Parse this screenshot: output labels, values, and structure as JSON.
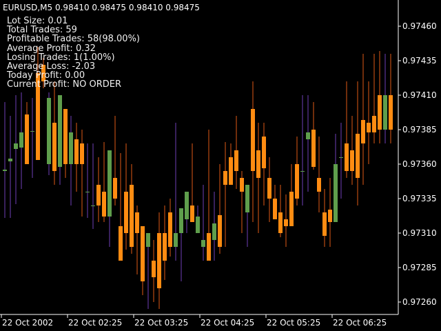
{
  "header": {
    "symbol": "EURUSD,M5",
    "ohlc": "0.98410 0.98475 0.98410 0.98475"
  },
  "stats": [
    "Lot Size: 0.01",
    "Total Trades: 59",
    "Profitable Trades: 58(98.00%)",
    "Average Profit: 0.32",
    "Losing Trades: 1(1.00%)",
    "Average Loss: -2.03",
    "Today Profit: 0.00",
    "Current Profit: NO ORDER"
  ],
  "colors": {
    "background": "#000000",
    "up_body": "#5f9e4c",
    "down_body": "#ff8c12",
    "up_wick": "#6f3fb7",
    "down_wick": "#e05a16",
    "axis": "#ffffff",
    "text": "#f0f0f0"
  },
  "chart_data": {
    "type": "candlestick",
    "y_ticks": [
      "0.97460",
      "0.97435",
      "0.97410",
      "0.97385",
      "0.97360",
      "0.97335",
      "0.97310",
      "0.97285",
      "0.97260"
    ],
    "x_ticks": [
      "22 Oct 2002",
      "22 Oct 02:25",
      "22 Oct 03:25",
      "22 Oct 04:25",
      "22 Oct 05:25",
      "22 Oct 06:25"
    ],
    "ylim": [
      0.97251,
      0.97479
    ],
    "candles": [
      {
        "o": 0.97355,
        "h": 0.97405,
        "l": 0.97321,
        "c": 0.97356
      },
      {
        "o": 0.97362,
        "h": 0.97395,
        "l": 0.97321,
        "c": 0.97364
      },
      {
        "o": 0.97371,
        "h": 0.9741,
        "l": 0.97331,
        "c": 0.97375
      },
      {
        "o": 0.97372,
        "h": 0.97412,
        "l": 0.97342,
        "c": 0.97383
      },
      {
        "o": 0.97396,
        "h": 0.97405,
        "l": 0.9736,
        "c": 0.9736
      },
      {
        "o": 0.97384,
        "h": 0.97408,
        "l": 0.9735,
        "c": 0.97384
      },
      {
        "o": 0.97426,
        "h": 0.97445,
        "l": 0.97363,
        "c": 0.97363
      },
      {
        "o": 0.97432,
        "h": 0.97437,
        "l": 0.97415,
        "c": 0.9742
      },
      {
        "o": 0.9736,
        "h": 0.97412,
        "l": 0.97352,
        "c": 0.97408
      },
      {
        "o": 0.9739,
        "h": 0.9742,
        "l": 0.97345,
        "c": 0.97355
      },
      {
        "o": 0.97358,
        "h": 0.97398,
        "l": 0.97345,
        "c": 0.9741
      },
      {
        "o": 0.974,
        "h": 0.974,
        "l": 0.9735,
        "c": 0.9736
      },
      {
        "o": 0.9736,
        "h": 0.97395,
        "l": 0.9733,
        "c": 0.97383
      },
      {
        "o": 0.97378,
        "h": 0.9739,
        "l": 0.9734,
        "c": 0.9736
      },
      {
        "o": 0.97375,
        "h": 0.97385,
        "l": 0.97322,
        "c": 0.9736
      },
      {
        "o": 0.9734,
        "h": 0.97375,
        "l": 0.97321,
        "c": 0.9734
      },
      {
        "o": 0.9733,
        "h": 0.97375,
        "l": 0.97313,
        "c": 0.9733
      },
      {
        "o": 0.97345,
        "h": 0.97365,
        "l": 0.97318,
        "c": 0.9733
      },
      {
        "o": 0.9734,
        "h": 0.97376,
        "l": 0.97318,
        "c": 0.97322
      },
      {
        "o": 0.97322,
        "h": 0.9734,
        "l": 0.973,
        "c": 0.9737
      },
      {
        "o": 0.9735,
        "h": 0.97395,
        "l": 0.9733,
        "c": 0.97335
      },
      {
        "o": 0.97315,
        "h": 0.97368,
        "l": 0.97298,
        "c": 0.9729
      },
      {
        "o": 0.9734,
        "h": 0.97375,
        "l": 0.97298,
        "c": 0.9731
      },
      {
        "o": 0.97345,
        "h": 0.9736,
        "l": 0.97295,
        "c": 0.973
      },
      {
        "o": 0.97325,
        "h": 0.9733,
        "l": 0.9728,
        "c": 0.9731
      },
      {
        "o": 0.97315,
        "h": 0.97315,
        "l": 0.97265,
        "c": 0.97275
      },
      {
        "o": 0.973,
        "h": 0.9731,
        "l": 0.97255,
        "c": 0.9731
      },
      {
        "o": 0.9729,
        "h": 0.97305,
        "l": 0.9726,
        "c": 0.97278
      },
      {
        "o": 0.9731,
        "h": 0.97325,
        "l": 0.97255,
        "c": 0.9727
      },
      {
        "o": 0.9731,
        "h": 0.9733,
        "l": 0.97276,
        "c": 0.9729
      },
      {
        "o": 0.97325,
        "h": 0.97335,
        "l": 0.97293,
        "c": 0.973
      },
      {
        "o": 0.973,
        "h": 0.9739,
        "l": 0.9729,
        "c": 0.9731
      },
      {
        "o": 0.9731,
        "h": 0.97318,
        "l": 0.97275,
        "c": 0.97328
      },
      {
        "o": 0.9732,
        "h": 0.9734,
        "l": 0.9731,
        "c": 0.9734
      },
      {
        "o": 0.9733,
        "h": 0.97375,
        "l": 0.9732,
        "c": 0.97318
      },
      {
        "o": 0.9731,
        "h": 0.9733,
        "l": 0.9731,
        "c": 0.97322
      },
      {
        "o": 0.973,
        "h": 0.97345,
        "l": 0.9729,
        "c": 0.97305
      },
      {
        "o": 0.9731,
        "h": 0.97385,
        "l": 0.9729,
        "c": 0.9729
      },
      {
        "o": 0.97305,
        "h": 0.9734,
        "l": 0.9729,
        "c": 0.97317
      },
      {
        "o": 0.97323,
        "h": 0.9736,
        "l": 0.97295,
        "c": 0.973
      },
      {
        "o": 0.97355,
        "h": 0.97376,
        "l": 0.973,
        "c": 0.97345
      },
      {
        "o": 0.97365,
        "h": 0.97375,
        "l": 0.9735,
        "c": 0.97345
      },
      {
        "o": 0.9737,
        "h": 0.97395,
        "l": 0.97342,
        "c": 0.97355
      },
      {
        "o": 0.9735,
        "h": 0.97355,
        "l": 0.9731,
        "c": 0.9734
      },
      {
        "o": 0.97325,
        "h": 0.9733,
        "l": 0.973,
        "c": 0.97345
      },
      {
        "o": 0.974,
        "h": 0.9742,
        "l": 0.97318,
        "c": 0.97355
      },
      {
        "o": 0.9737,
        "h": 0.9739,
        "l": 0.9731,
        "c": 0.9735
      },
      {
        "o": 0.9738,
        "h": 0.9739,
        "l": 0.9733,
        "c": 0.97357
      },
      {
        "o": 0.9735,
        "h": 0.97365,
        "l": 0.97318,
        "c": 0.97335
      },
      {
        "o": 0.97335,
        "h": 0.97345,
        "l": 0.9732,
        "c": 0.9732
      },
      {
        "o": 0.97325,
        "h": 0.97345,
        "l": 0.97307,
        "c": 0.9731
      },
      {
        "o": 0.9732,
        "h": 0.97338,
        "l": 0.973,
        "c": 0.97315
      },
      {
        "o": 0.9734,
        "h": 0.9736,
        "l": 0.9732,
        "c": 0.97315
      },
      {
        "o": 0.9736,
        "h": 0.9738,
        "l": 0.9733,
        "c": 0.97335
      },
      {
        "o": 0.97355,
        "h": 0.9741,
        "l": 0.9733,
        "c": 0.97355
      },
      {
        "o": 0.97378,
        "h": 0.9741,
        "l": 0.9734,
        "c": 0.97383
      },
      {
        "o": 0.97385,
        "h": 0.97405,
        "l": 0.97356,
        "c": 0.97358
      },
      {
        "o": 0.9735,
        "h": 0.9738,
        "l": 0.97325,
        "c": 0.9734
      },
      {
        "o": 0.97325,
        "h": 0.97342,
        "l": 0.973,
        "c": 0.97308
      },
      {
        "o": 0.97327,
        "h": 0.9735,
        "l": 0.973,
        "c": 0.97318
      },
      {
        "o": 0.97318,
        "h": 0.97382,
        "l": 0.9732,
        "c": 0.9736
      },
      {
        "o": 0.97365,
        "h": 0.9739,
        "l": 0.97335,
        "c": 0.97365
      },
      {
        "o": 0.97375,
        "h": 0.9742,
        "l": 0.9735,
        "c": 0.97355
      },
      {
        "o": 0.9737,
        "h": 0.97395,
        "l": 0.97345,
        "c": 0.97355
      },
      {
        "o": 0.97382,
        "h": 0.9742,
        "l": 0.9733,
        "c": 0.9735
      },
      {
        "o": 0.97392,
        "h": 0.9744,
        "l": 0.97345,
        "c": 0.97375
      },
      {
        "o": 0.9739,
        "h": 0.9742,
        "l": 0.9736,
        "c": 0.97383
      },
      {
        "o": 0.97395,
        "h": 0.9744,
        "l": 0.97375,
        "c": 0.97383
      },
      {
        "o": 0.9741,
        "h": 0.97442,
        "l": 0.97375,
        "c": 0.97385
      },
      {
        "o": 0.97385,
        "h": 0.9744,
        "l": 0.97375,
        "c": 0.9741
      },
      {
        "o": 0.9741,
        "h": 0.9744,
        "l": 0.97375,
        "c": 0.97385
      }
    ]
  }
}
